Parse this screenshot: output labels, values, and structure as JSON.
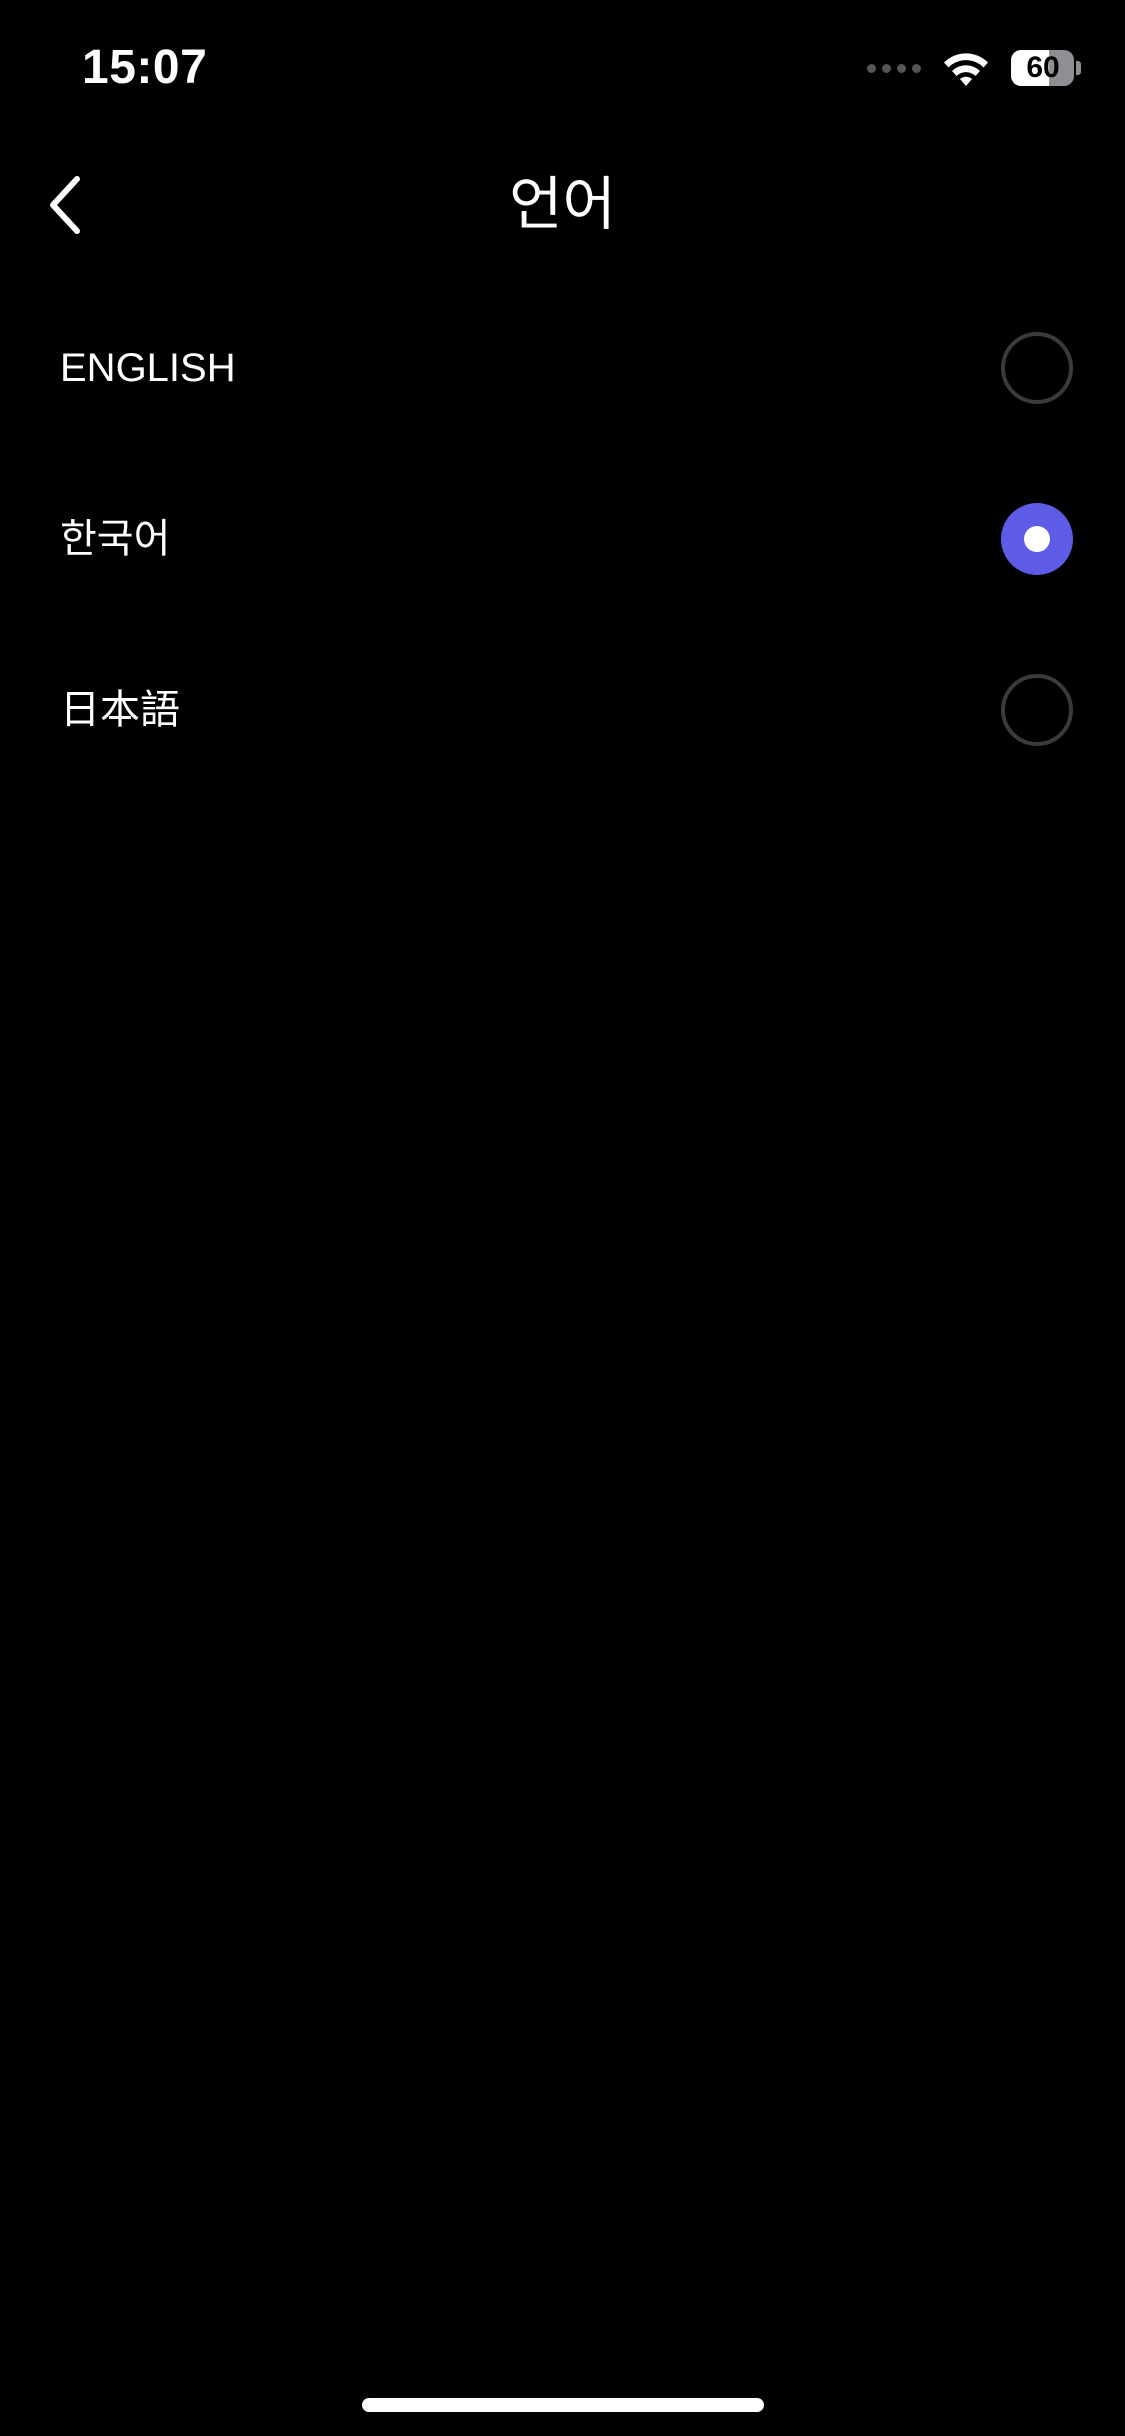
{
  "status_bar": {
    "time": "15:07",
    "battery_level": "60",
    "battery_percent": 60
  },
  "header": {
    "title": "언어",
    "back_icon": "chevron-left-icon"
  },
  "languages": [
    {
      "label": "ENGLISH",
      "selected": false
    },
    {
      "label": "한국어",
      "selected": true
    },
    {
      "label": "日本語",
      "selected": false
    }
  ],
  "colors": {
    "background": "#000000",
    "accent": "#5e5ce6",
    "radio_border": "#3a3a3c",
    "text": "#ffffff"
  }
}
